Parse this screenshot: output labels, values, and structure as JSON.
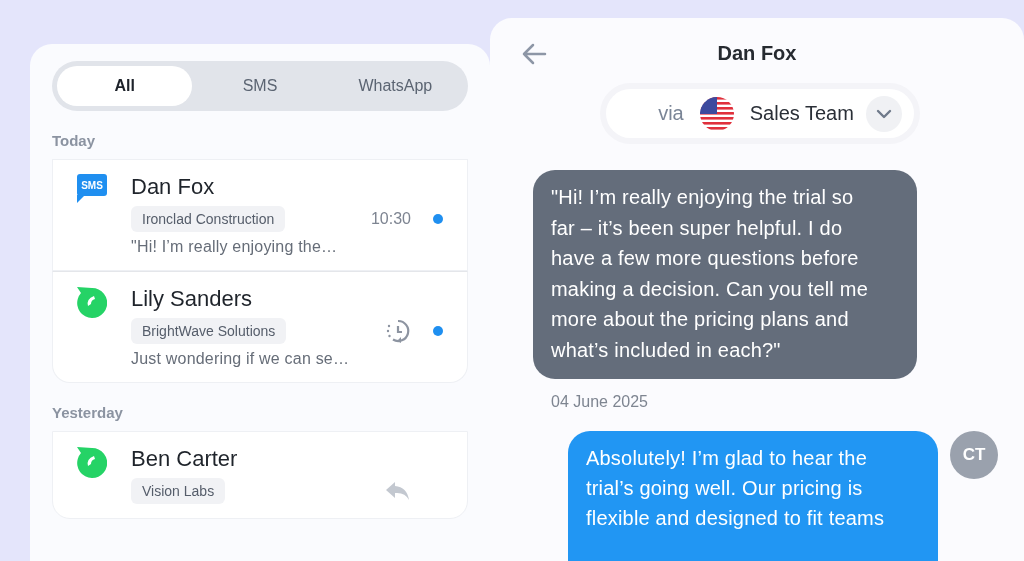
{
  "filters": [
    {
      "label": "All",
      "selected": true
    },
    {
      "label": "SMS",
      "selected": false
    },
    {
      "label": "WhatsApp",
      "selected": false
    }
  ],
  "groups": [
    {
      "label": "Today",
      "conversations": [
        {
          "channel": {
            "kind": "sms",
            "label": "SMS"
          },
          "name": "Dan Fox",
          "company": "Ironclad Construction",
          "status": {
            "kind": "time",
            "text": "10:30"
          },
          "unread": true,
          "preview": "\"Hi! I’m really enjoying the…"
        },
        {
          "channel": {
            "kind": "whatsapp"
          },
          "name": "Lily Sanders",
          "company": "BrightWave Solutions",
          "status": {
            "kind": "scheduled"
          },
          "unread": true,
          "preview": "Just wondering if we can se…"
        }
      ]
    },
    {
      "label": "Yesterday",
      "conversations": [
        {
          "channel": {
            "kind": "whatsapp"
          },
          "name": "Ben Carter",
          "company": "Vision Labs",
          "status": {
            "kind": "replied"
          },
          "unread": false
        }
      ]
    }
  ],
  "chat": {
    "title": "Dan Fox",
    "via_label": "via",
    "sender": "Sales Team",
    "messages": [
      {
        "kind": "incoming",
        "text": "\"Hi! I’m really enjoying the trial so far – it’s been super helpful. I do have a few more questions before making a decision. Can you tell me more about the pricing plans and what’s included in each?\""
      },
      {
        "kind": "date",
        "text": "04 June 2025"
      },
      {
        "kind": "outgoing",
        "text": "Absolutely! I’m glad to hear the trial’s going well. Our pricing is flexible and designed to fit teams",
        "avatar": "CT"
      }
    ]
  }
}
